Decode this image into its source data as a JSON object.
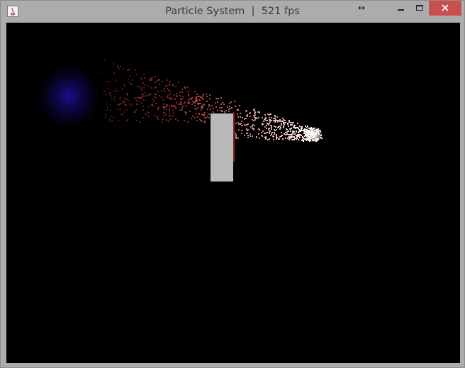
{
  "window": {
    "title": "Particle System  |  521 fps",
    "app_icon": "java-icon",
    "resize_icon": "horizontal-resize-icon",
    "controls": [
      "minimize-icon",
      "maximize-icon",
      "close-icon"
    ],
    "close_color": "#c7504f"
  },
  "scene": {
    "background": "#000000",
    "attractor_color": "#1c0e96",
    "obstacle_color": "#b9b9b9",
    "particle_color": "#ff9a9a",
    "emitter_color": "#ffffff"
  }
}
